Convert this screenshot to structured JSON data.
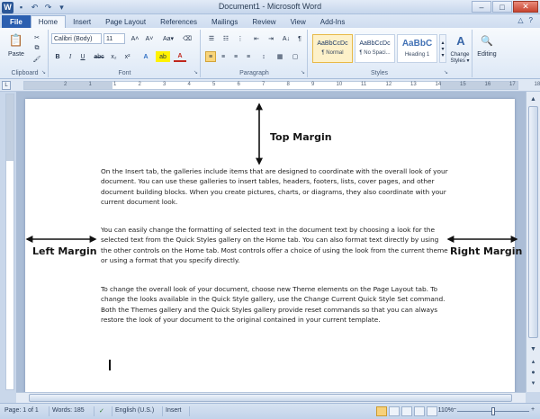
{
  "window": {
    "title": "Document1 - Microsoft Word"
  },
  "qat": {
    "word_letter": "W",
    "save": "▪",
    "undo": "↶",
    "redo": "↷",
    "customize": "▾"
  },
  "window_controls": {
    "minimize": "–",
    "maximize": "□",
    "close": "✕"
  },
  "tabs": [
    {
      "label": "File"
    },
    {
      "label": "Home"
    },
    {
      "label": "Insert"
    },
    {
      "label": "Page Layout"
    },
    {
      "label": "References"
    },
    {
      "label": "Mailings"
    },
    {
      "label": "Review"
    },
    {
      "label": "View"
    },
    {
      "label": "Add-Ins"
    }
  ],
  "help": {
    "collapse": "△",
    "question": "?"
  },
  "ribbon": {
    "clipboard": {
      "label": "Clipboard",
      "paste": "Paste",
      "cut": "✂",
      "copy": "⧉",
      "format_painter": "🖌"
    },
    "font": {
      "label": "Font",
      "font_name": "Calibri (Body)",
      "font_size": "11",
      "grow": "A˄",
      "shrink": "A˅",
      "change_case": "Aa▾",
      "clear": "⌫",
      "bold": "B",
      "italic": "I",
      "underline": "U",
      "strike": "abc",
      "subscript": "x₂",
      "superscript": "x²",
      "text_effects": "A",
      "highlight": "ab",
      "font_color": "A"
    },
    "paragraph": {
      "label": "Paragraph",
      "bullets": "☰",
      "numbering": "☷",
      "multilevel": "⋮",
      "decrease_indent": "⇤",
      "increase_indent": "⇥",
      "sort": "A↓",
      "pilcrow": "¶",
      "align_left": "≡",
      "center": "≡",
      "align_right": "≡",
      "justify": "≡",
      "line_spacing": "↕",
      "shading": "▦",
      "borders": "▢"
    },
    "styles": {
      "label": "Styles",
      "items": [
        {
          "sample": "AaBbCcDc",
          "name": "¶ Normal"
        },
        {
          "sample": "AaBbCcDc",
          "name": "¶ No Spaci..."
        },
        {
          "sample": "AaBbC",
          "name": "Heading 1"
        }
      ],
      "change_styles": "Change Styles ▾",
      "editing": "Editing"
    }
  },
  "ruler": {
    "tab_selector": "L",
    "numbers": [
      "2",
      "1",
      "1",
      "2",
      "3",
      "4",
      "5",
      "6",
      "7",
      "8",
      "9",
      "10",
      "11",
      "12",
      "13",
      "14",
      "15",
      "16",
      "17",
      "18"
    ]
  },
  "document": {
    "paragraphs": [
      "On the Insert tab, the galleries include items that are designed to coordinate with the overall look of your document. You can use these galleries to insert tables, headers, footers, lists, cover pages, and other document building blocks. When you create pictures, charts, or diagrams, they also coordinate with your current document look.",
      "You can easily change the formatting of selected text in the document text by choosing a look for the selected text from the Quick Styles gallery on the Home tab. You can also format text directly by using the other controls on the Home tab. Most controls offer a choice of using the look from the current theme or using a format that you specify directly.",
      "To change the overall look of your document, choose new Theme elements on the Page Layout tab. To change the looks available in the Quick Style gallery, use the Change Current Quick Style Set command. Both the Themes gallery and the Quick Styles gallery provide reset commands so that you can always restore the look of your document to the original contained in your current template."
    ]
  },
  "annotations": {
    "top": "Top Margin",
    "left": "Left Margin",
    "right": "Right Margin"
  },
  "scrollbar": {
    "up": "▲",
    "down": "▼",
    "prev_page": "▴",
    "select_browse": "●",
    "next_page": "▾"
  },
  "status": {
    "page": "Page: 1 of 1",
    "words": "Words: 185",
    "proofing": "✓",
    "language": "English (U.S.)",
    "mode": "Insert",
    "zoom": "110%",
    "zoom_out": "−",
    "zoom_in": "+"
  }
}
